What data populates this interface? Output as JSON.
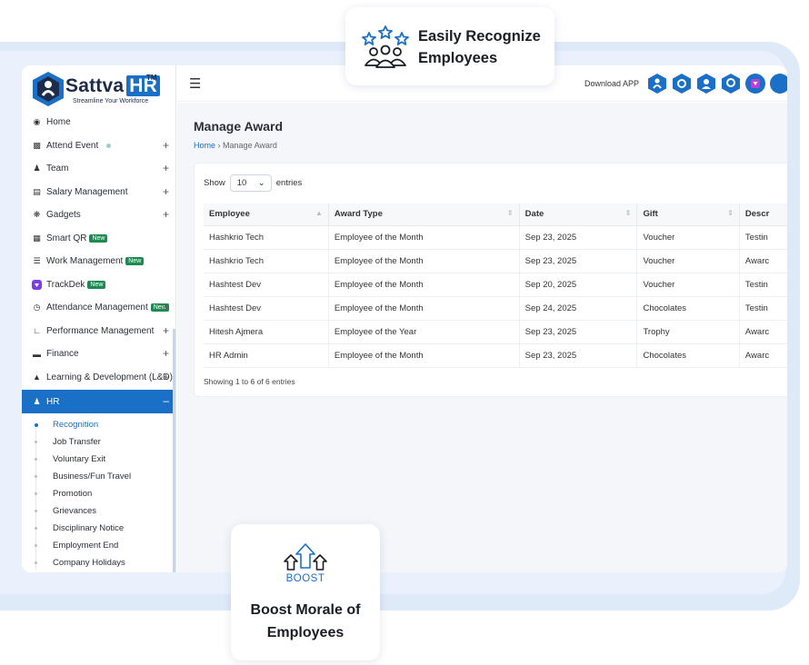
{
  "colors": {
    "primary": "#1a6fc6",
    "badge": "#1e8a52",
    "navy": "#1c2c4a"
  },
  "brand": {
    "name": "Sattva",
    "hr": "HR",
    "tm": "TM",
    "tagline": "Streamline Your Workforce"
  },
  "callouts": {
    "recognize": {
      "line1": "Easily Recognize",
      "line2": "Employees",
      "icon": "people-stars-icon"
    },
    "boost": {
      "icon_text": "BOOST",
      "line1": "Boost Morale of",
      "line2": "Employees",
      "icon": "boost-arrows-icon"
    }
  },
  "header": {
    "download_label": "Download APP"
  },
  "sidebar": {
    "items": [
      {
        "label": "Home",
        "icon": "dashboard-icon"
      },
      {
        "label": "Attend Event",
        "icon": "calendar-icon"
      },
      {
        "label": "Team",
        "icon": "users-icon"
      },
      {
        "label": "Salary Management",
        "icon": "document-icon"
      },
      {
        "label": "Gadgets",
        "icon": "gadget-icon"
      },
      {
        "label": "Smart QR",
        "badge": "New",
        "icon": "qr-icon"
      },
      {
        "label": "Work Management",
        "badge": "New",
        "icon": "list-icon"
      },
      {
        "label": "TrackDek",
        "badge": "New",
        "icon": "trackdek-icon"
      },
      {
        "label": "Attendance Management",
        "badge": "New",
        "icon": "clock-icon"
      },
      {
        "label": "Performance Management",
        "icon": "chart-icon"
      },
      {
        "label": "Finance",
        "icon": "wallet-icon"
      },
      {
        "label": "Learning & Development (L&D)",
        "icon": "graduation-icon"
      },
      {
        "label": "HR",
        "icon": "user-group-icon"
      }
    ],
    "plus": "+",
    "minus": "–",
    "sub_items": [
      "Recognition",
      "Job Transfer",
      "Voluntary Exit",
      "Business/Fun Travel",
      "Promotion",
      "Grievances",
      "Disciplinary Notice",
      "Employment End",
      "Company Holidays"
    ]
  },
  "main": {
    "title": "Manage Award",
    "breadcrumb": {
      "home": "Home",
      "sep": "›",
      "current": "Manage Award"
    },
    "show": {
      "prefix": "Show",
      "value": "10",
      "suffix": "entries"
    },
    "columns": [
      "Employee",
      "Award Type",
      "Date",
      "Gift",
      "Descr"
    ],
    "rows": [
      [
        "Hashkrio Tech",
        "Employee of the Month",
        "Sep 23, 2025",
        "Voucher",
        "Testin"
      ],
      [
        "Hashkrio Tech",
        "Employee of the Month",
        "Sep 23, 2025",
        "Voucher",
        "Awarc"
      ],
      [
        "Hashtest Dev",
        "Employee of the Month",
        "Sep 20, 2025",
        "Voucher",
        "Testin"
      ],
      [
        "Hashtest Dev",
        "Employee of the Month",
        "Sep 24, 2025",
        "Chocolates",
        "Testin"
      ],
      [
        "Hitesh Ajmera",
        "Employee of the Year",
        "Sep 23, 2025",
        "Trophy",
        "Awarc"
      ],
      [
        "HR Admin",
        "Employee of the Month",
        "Sep 23, 2025",
        "Chocolates",
        "Awarc"
      ]
    ],
    "footer": "Showing 1 to 6 of 6 entries"
  }
}
